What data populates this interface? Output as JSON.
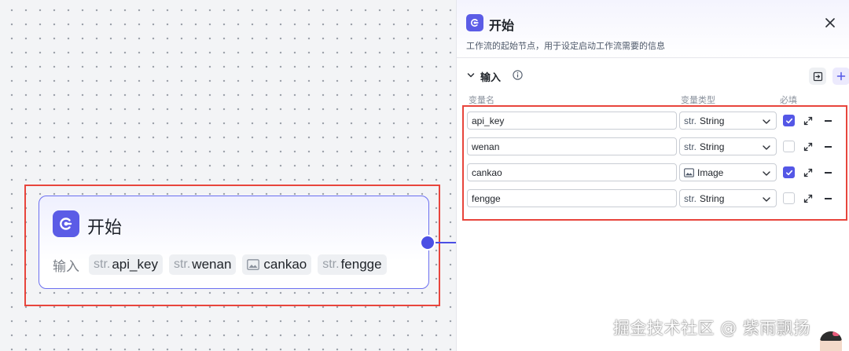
{
  "canvas_node": {
    "title": "开始",
    "inputs_label": "输入",
    "chips": [
      {
        "type_prefix": "str.",
        "name": "api_key",
        "icon": null
      },
      {
        "type_prefix": "str.",
        "name": "wenan",
        "icon": null
      },
      {
        "type_prefix": "",
        "name": "cankao",
        "icon": "image-icon"
      },
      {
        "type_prefix": "str.",
        "name": "fengge",
        "icon": null
      }
    ]
  },
  "panel": {
    "title": "开始",
    "description": "工作流的起始节点，用于设定启动工作流需要的信息",
    "section_title": "输入",
    "columns": {
      "name": "变量名",
      "type": "变量类型",
      "required": "必填"
    },
    "rows": [
      {
        "name": "api_key",
        "type_prefix": "str.",
        "type": "String",
        "required": true
      },
      {
        "name": "wenan",
        "type_prefix": "str.",
        "type": "String",
        "required": false
      },
      {
        "name": "cankao",
        "type_prefix": "",
        "type": "Image",
        "required": true
      },
      {
        "name": "fengge",
        "type_prefix": "str.",
        "type": "String",
        "required": false
      }
    ]
  },
  "watermark": "掘金技术社区 @ 紫雨飘扬",
  "colors": {
    "accent": "#5b5ce6",
    "highlight_box": "#e8453c",
    "edge": "#4b4fe4"
  }
}
